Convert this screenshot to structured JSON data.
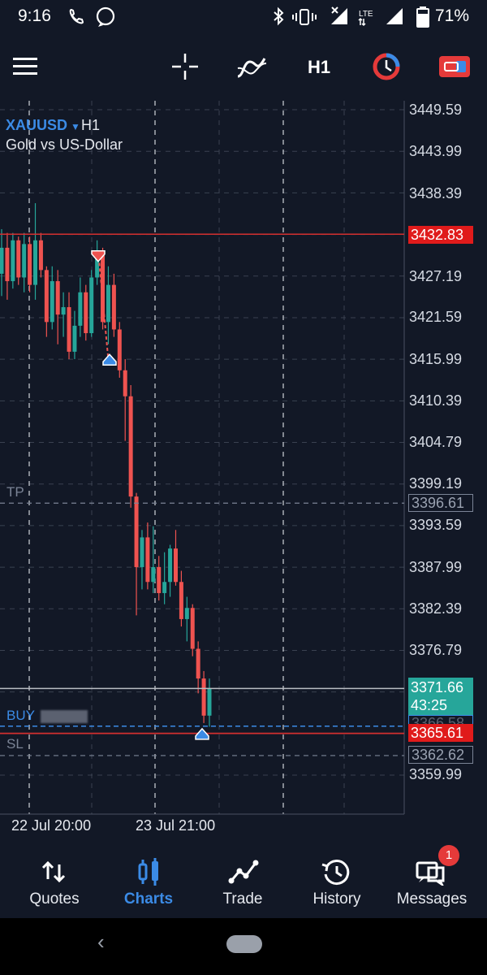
{
  "status_bar": {
    "time": "9:16",
    "battery": "71%",
    "network": "LTE"
  },
  "toolbar": {
    "timeframe": "H1",
    "icons": [
      "menu-icon",
      "crosshair-icon",
      "indicators-icon",
      "timeframe",
      "one-click-trading-icon",
      "trade-toggle-icon"
    ]
  },
  "chart": {
    "symbol": "XAUUSD",
    "timeframe": "H1",
    "description": "Gold vs US-Dollar",
    "y_labels": [
      "3449.59",
      "3443.99",
      "3438.39",
      "3427.19",
      "3421.59",
      "3415.99",
      "3410.39",
      "3404.79",
      "3399.19",
      "3393.59",
      "3387.99",
      "3382.39",
      "3376.79",
      "3359.99"
    ],
    "x_labels": [
      "22 Jul 20:00",
      "23 Jul 21:00"
    ],
    "levels": {
      "tp_label": "TP",
      "tp_price": "3396.61",
      "sl_label": "SL",
      "sl_price": "3362.62",
      "buy_label": "BUY",
      "buy_price": "3366.58",
      "bid_price": "3365.61",
      "ask_line_price": "3432.83",
      "current_price": "3371.66",
      "countdown": "43:25"
    },
    "colors": {
      "bull": "#26a69a",
      "bear": "#ef5350",
      "grid": "#3a4150",
      "red_line": "#d32f2f",
      "tag_red": "#e01b1b",
      "tag_green": "#26a69a",
      "accent": "#3b8be6"
    }
  },
  "chart_data": {
    "type": "candlestick",
    "symbol": "XAUUSD",
    "timeframe": "H1",
    "ylim": [
      3357.0,
      3452.0
    ],
    "candles": [
      [
        3427.5,
        3433.5,
        3424.5,
        3431.0
      ],
      [
        3431.0,
        3433.0,
        3424.0,
        3426.5
      ],
      [
        3426.5,
        3433.0,
        3425.5,
        3432.0
      ],
      [
        3432.0,
        3432.5,
        3426.0,
        3427.0
      ],
      [
        3427.0,
        3433.0,
        3425.0,
        3431.5
      ],
      [
        3431.5,
        3432.5,
        3425.0,
        3426.0
      ],
      [
        3426.0,
        3437.0,
        3424.0,
        3432.0
      ],
      [
        3432.0,
        3433.0,
        3427.0,
        3428.0
      ],
      [
        3428.0,
        3428.5,
        3419.0,
        3421.0
      ],
      [
        3421.0,
        3428.5,
        3420.0,
        3426.5
      ],
      [
        3426.5,
        3428.0,
        3418.0,
        3422.0
      ],
      [
        3422.0,
        3425.0,
        3419.0,
        3423.0
      ],
      [
        3423.0,
        3425.0,
        3416.0,
        3417.0
      ],
      [
        3417.0,
        3422.5,
        3416.0,
        3420.5
      ],
      [
        3420.5,
        3427.0,
        3419.0,
        3425.0
      ],
      [
        3425.0,
        3426.0,
        3418.5,
        3419.5
      ],
      [
        3419.5,
        3428.0,
        3419.0,
        3427.0
      ],
      [
        3427.0,
        3432.0,
        3426.0,
        3430.0
      ],
      [
        3430.0,
        3431.0,
        3420.0,
        3421.0
      ],
      [
        3421.0,
        3428.5,
        3418.0,
        3426.0
      ],
      [
        3426.0,
        3427.5,
        3419.0,
        3420.0
      ],
      [
        3420.0,
        3421.0,
        3413.5,
        3414.5
      ],
      [
        3414.5,
        3416.0,
        3405.0,
        3411.0
      ],
      [
        3411.0,
        3412.5,
        3396.0,
        3397.5
      ],
      [
        3397.5,
        3398.0,
        3381.5,
        3388.0
      ],
      [
        3388.0,
        3393.0,
        3385.0,
        3392.0
      ],
      [
        3392.0,
        3394.0,
        3385.0,
        3386.0
      ],
      [
        3386.0,
        3393.5,
        3384.5,
        3388.0
      ],
      [
        3388.0,
        3389.5,
        3383.5,
        3384.5
      ],
      [
        3384.5,
        3390.0,
        3383.0,
        3386.0
      ],
      [
        3386.0,
        3391.0,
        3384.0,
        3390.5
      ],
      [
        3390.5,
        3393.0,
        3385.5,
        3386.0
      ],
      [
        3386.0,
        3387.5,
        3380.0,
        3381.0
      ],
      [
        3381.0,
        3384.0,
        3378.0,
        3382.5
      ],
      [
        3382.5,
        3383.0,
        3376.0,
        3377.0
      ],
      [
        3377.0,
        3378.0,
        3371.0,
        3373.0
      ],
      [
        3373.0,
        3374.0,
        3367.0,
        3368.0
      ],
      [
        3368.0,
        3373.0,
        3366.5,
        3371.66
      ]
    ],
    "buy_price": 3366.58,
    "tp": 3396.61,
    "sl": 3362.62,
    "bid": 3365.61,
    "ask_line": 3432.83,
    "x_labels": [
      "22 Jul 20:00",
      "23 Jul 21:00"
    ]
  },
  "bottom_nav": {
    "items": [
      {
        "label": "Quotes",
        "icon": "quotes-icon"
      },
      {
        "label": "Charts",
        "icon": "charts-icon"
      },
      {
        "label": "Trade",
        "icon": "trade-icon"
      },
      {
        "label": "History",
        "icon": "history-icon"
      },
      {
        "label": "Messages",
        "icon": "messages-icon"
      }
    ],
    "active": "Charts",
    "messages_badge": "1"
  }
}
